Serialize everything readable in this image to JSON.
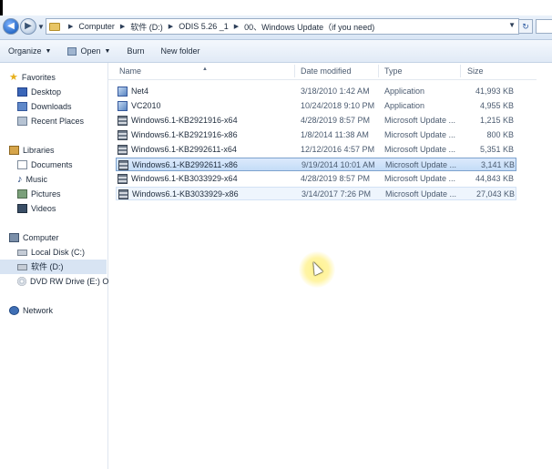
{
  "address": {
    "crumbs": [
      "Computer",
      "软件 (D:)",
      "ODIS 5.26 _1",
      "00、Windows Update（if you need)"
    ]
  },
  "toolbar": {
    "organize": "Organize",
    "open": "Open",
    "burn": "Burn",
    "new_folder": "New folder"
  },
  "nav": {
    "favorites": "Favorites",
    "desktop": "Desktop",
    "downloads": "Downloads",
    "recent": "Recent Places",
    "libraries": "Libraries",
    "documents": "Documents",
    "music": "Music",
    "pictures": "Pictures",
    "videos": "Videos",
    "computer": "Computer",
    "local_disk": "Local Disk (C:)",
    "soft_disk": "软件 (D:)",
    "dvd": "DVD RW Drive (E:) O",
    "network": "Network"
  },
  "columns": {
    "name": "Name",
    "date": "Date modified",
    "type": "Type",
    "size": "Size"
  },
  "files": [
    {
      "name": "Net4",
      "date": "3/18/2010 1:42 AM",
      "type": "Application",
      "size": "41,993 KB",
      "icon": "application-icon"
    },
    {
      "name": "VC2010",
      "date": "10/24/2018 9:10 PM",
      "type": "Application",
      "size": "4,955 KB",
      "icon": "application-icon"
    },
    {
      "name": "Windows6.1-KB2921916-x64",
      "date": "4/28/2019 8:57 PM",
      "type": "Microsoft Update ...",
      "size": "1,215 KB",
      "icon": "update-package-icon"
    },
    {
      "name": "Windows6.1-KB2921916-x86",
      "date": "1/8/2014 11:38 AM",
      "type": "Microsoft Update ...",
      "size": "800 KB",
      "icon": "update-package-icon"
    },
    {
      "name": "Windows6.1-KB2992611-x64",
      "date": "12/12/2016 4:57 PM",
      "type": "Microsoft Update ...",
      "size": "5,351 KB",
      "icon": "update-package-icon"
    },
    {
      "name": "Windows6.1-KB2992611-x86",
      "date": "9/19/2014 10:01 AM",
      "type": "Microsoft Update ...",
      "size": "3,141 KB",
      "icon": "update-package-icon"
    },
    {
      "name": "Windows6.1-KB3033929-x64",
      "date": "4/28/2019 8:57 PM",
      "type": "Microsoft Update ...",
      "size": "44,843 KB",
      "icon": "update-package-icon"
    },
    {
      "name": "Windows6.1-KB3033929-x86",
      "date": "3/14/2017 7:26 PM",
      "type": "Microsoft Update ...",
      "size": "27,043 KB",
      "icon": "update-package-icon"
    }
  ],
  "selected_row": 5,
  "hover_row": 7,
  "colors": {
    "selection": "#c4dcf7",
    "selection_border": "#7da2ce",
    "cursor_highlight": "#ffeb5a"
  }
}
